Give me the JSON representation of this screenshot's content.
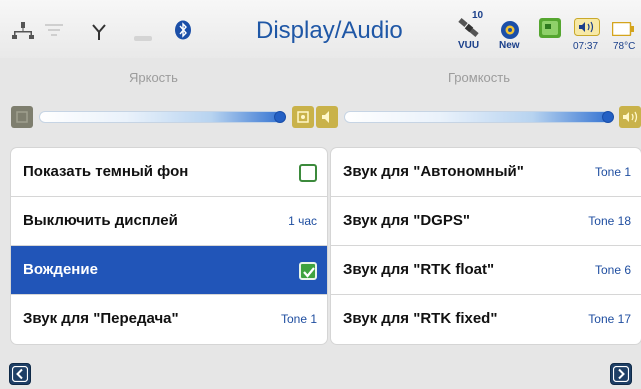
{
  "header": {
    "title": "Display/Audio",
    "satellite_count": "10",
    "satellite_label": "VUU",
    "new_label": "New",
    "time": "07:37",
    "temperature": "78°C"
  },
  "status_icons": [
    "ethernet-icon",
    "wifi-icon",
    "antenna-icon",
    "signal-icon",
    "bluetooth-icon",
    "satellite-icon",
    "notification-icon",
    "map-icon",
    "volume-icon",
    "battery-icon"
  ],
  "brightness": {
    "label": "Яркость",
    "level": 1.0
  },
  "volume": {
    "label": "Громкость",
    "level": 1.0
  },
  "colors": {
    "accent": "#2155b8",
    "title": "#1f57a6",
    "checkbox": "#3fa33f",
    "slider_button": "#c9b24a"
  },
  "left_list": [
    {
      "label": "Показать темный фон",
      "type": "checkbox",
      "checked": false
    },
    {
      "label": "Выключить дисплей",
      "type": "value",
      "value": "1 час"
    },
    {
      "label": "Вождение",
      "type": "checkbox",
      "checked": true,
      "selected": true
    },
    {
      "label": "Звук для \"Передача\"",
      "type": "value",
      "value": "Tone 1"
    }
  ],
  "right_list": [
    {
      "label": "Звук для \"Автономный\"",
      "value": "Tone 1"
    },
    {
      "label": "Звук для \"DGPS\"",
      "value": "Tone 18"
    },
    {
      "label": "Звук для \"RTK float\"",
      "value": "Tone 6"
    },
    {
      "label": "Звук для \"RTK fixed\"",
      "value": "Tone 17"
    }
  ],
  "nav": {
    "prev_icon": "chevron-left-icon",
    "next_icon": "chevron-right-icon"
  }
}
